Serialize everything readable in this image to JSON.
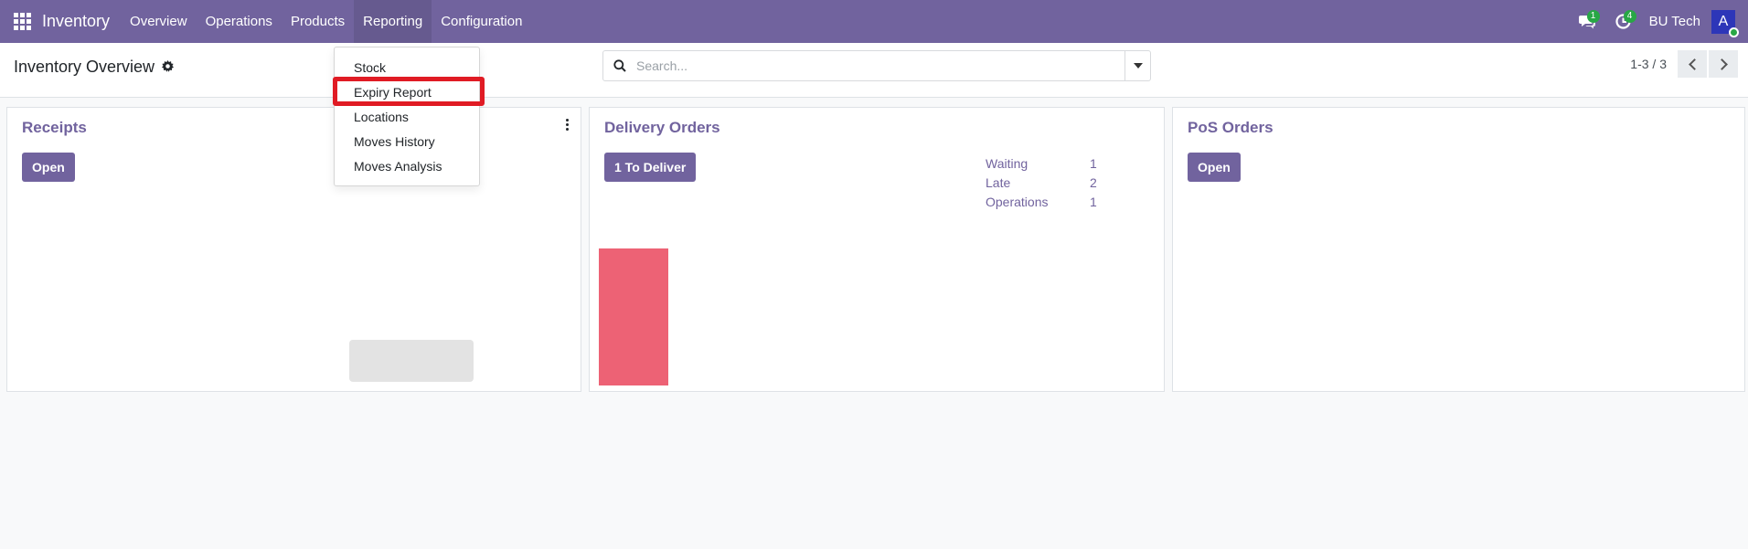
{
  "navbar": {
    "brand": "Inventory",
    "menu": [
      "Overview",
      "Operations",
      "Products",
      "Reporting",
      "Configuration"
    ],
    "active_menu": "Reporting",
    "messages_badge": "1",
    "activities_badge": "4",
    "company": "BU Tech",
    "avatar_initial": "A"
  },
  "control_panel": {
    "title": "Inventory Overview",
    "search_placeholder": "Search...",
    "pager": "1-3 / 3"
  },
  "reporting_dropdown": {
    "items": [
      "Stock",
      "Expiry Report",
      "Locations",
      "Moves History",
      "Moves Analysis"
    ],
    "highlighted": "Expiry Report"
  },
  "cards": [
    {
      "title": "Receipts",
      "button": "Open"
    },
    {
      "title": "Delivery Orders",
      "button": "1 To Deliver",
      "stats": [
        {
          "label": "Waiting",
          "value": "1"
        },
        {
          "label": "Late",
          "value": "2"
        },
        {
          "label": "Operations",
          "value": "1"
        }
      ]
    },
    {
      "title": "PoS Orders",
      "button": "Open"
    }
  ],
  "colors": {
    "primary": "#71639e",
    "bar": "#ed6275",
    "highlight": "#e01b24",
    "badge": "#28a745"
  }
}
